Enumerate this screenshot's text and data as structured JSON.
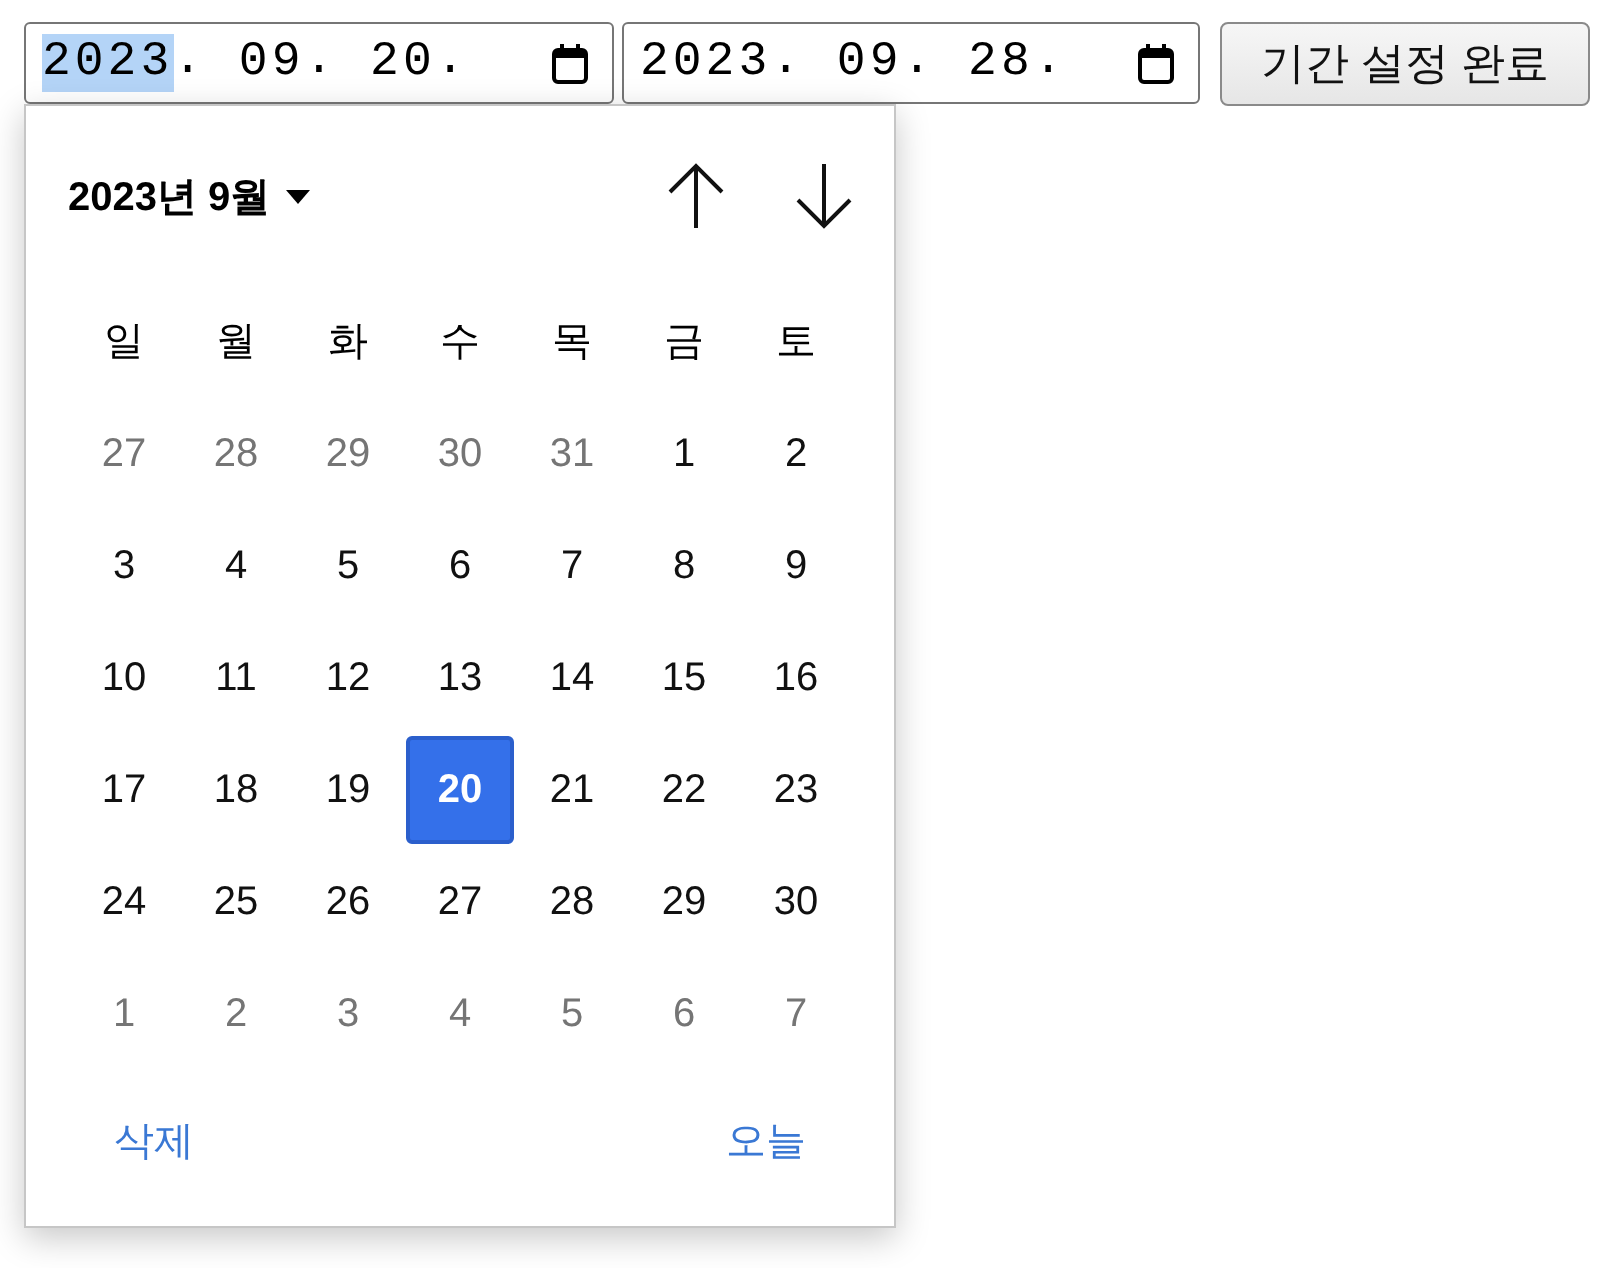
{
  "date_fields": [
    {
      "segments": [
        {
          "text": "2023",
          "suffix": ".",
          "selected": true
        },
        {
          "text": "09",
          "suffix": ".",
          "selected": false
        },
        {
          "text": "20",
          "suffix": ".",
          "selected": false
        }
      ]
    },
    {
      "segments": [
        {
          "text": "2023",
          "suffix": ".",
          "selected": false
        },
        {
          "text": "09",
          "suffix": ".",
          "selected": false
        },
        {
          "text": "28",
          "suffix": ".",
          "selected": false
        }
      ]
    }
  ],
  "apply_button": {
    "label": "기간 설정 완료"
  },
  "calendar": {
    "month_label": "2023년 9월",
    "weekdays": [
      "일",
      "월",
      "화",
      "수",
      "목",
      "금",
      "토"
    ],
    "weeks": [
      [
        {
          "day": "27",
          "outside": true,
          "selected": false
        },
        {
          "day": "28",
          "outside": true,
          "selected": false
        },
        {
          "day": "29",
          "outside": true,
          "selected": false
        },
        {
          "day": "30",
          "outside": true,
          "selected": false
        },
        {
          "day": "31",
          "outside": true,
          "selected": false
        },
        {
          "day": "1",
          "outside": false,
          "selected": false
        },
        {
          "day": "2",
          "outside": false,
          "selected": false
        }
      ],
      [
        {
          "day": "3",
          "outside": false,
          "selected": false
        },
        {
          "day": "4",
          "outside": false,
          "selected": false
        },
        {
          "day": "5",
          "outside": false,
          "selected": false
        },
        {
          "day": "6",
          "outside": false,
          "selected": false
        },
        {
          "day": "7",
          "outside": false,
          "selected": false
        },
        {
          "day": "8",
          "outside": false,
          "selected": false
        },
        {
          "day": "9",
          "outside": false,
          "selected": false
        }
      ],
      [
        {
          "day": "10",
          "outside": false,
          "selected": false
        },
        {
          "day": "11",
          "outside": false,
          "selected": false
        },
        {
          "day": "12",
          "outside": false,
          "selected": false
        },
        {
          "day": "13",
          "outside": false,
          "selected": false
        },
        {
          "day": "14",
          "outside": false,
          "selected": false
        },
        {
          "day": "15",
          "outside": false,
          "selected": false
        },
        {
          "day": "16",
          "outside": false,
          "selected": false
        }
      ],
      [
        {
          "day": "17",
          "outside": false,
          "selected": false
        },
        {
          "day": "18",
          "outside": false,
          "selected": false
        },
        {
          "day": "19",
          "outside": false,
          "selected": false
        },
        {
          "day": "20",
          "outside": false,
          "selected": true
        },
        {
          "day": "21",
          "outside": false,
          "selected": false
        },
        {
          "day": "22",
          "outside": false,
          "selected": false
        },
        {
          "day": "23",
          "outside": false,
          "selected": false
        }
      ],
      [
        {
          "day": "24",
          "outside": false,
          "selected": false
        },
        {
          "day": "25",
          "outside": false,
          "selected": false
        },
        {
          "day": "26",
          "outside": false,
          "selected": false
        },
        {
          "day": "27",
          "outside": false,
          "selected": false
        },
        {
          "day": "28",
          "outside": false,
          "selected": false
        },
        {
          "day": "29",
          "outside": false,
          "selected": false
        },
        {
          "day": "30",
          "outside": false,
          "selected": false
        }
      ],
      [
        {
          "day": "1",
          "outside": true,
          "selected": false
        },
        {
          "day": "2",
          "outside": true,
          "selected": false
        },
        {
          "day": "3",
          "outside": true,
          "selected": false
        },
        {
          "day": "4",
          "outside": true,
          "selected": false
        },
        {
          "day": "5",
          "outside": true,
          "selected": false
        },
        {
          "day": "6",
          "outside": true,
          "selected": false
        },
        {
          "day": "7",
          "outside": true,
          "selected": false
        }
      ]
    ],
    "footer": {
      "clear": "삭제",
      "today": "오늘"
    }
  }
}
